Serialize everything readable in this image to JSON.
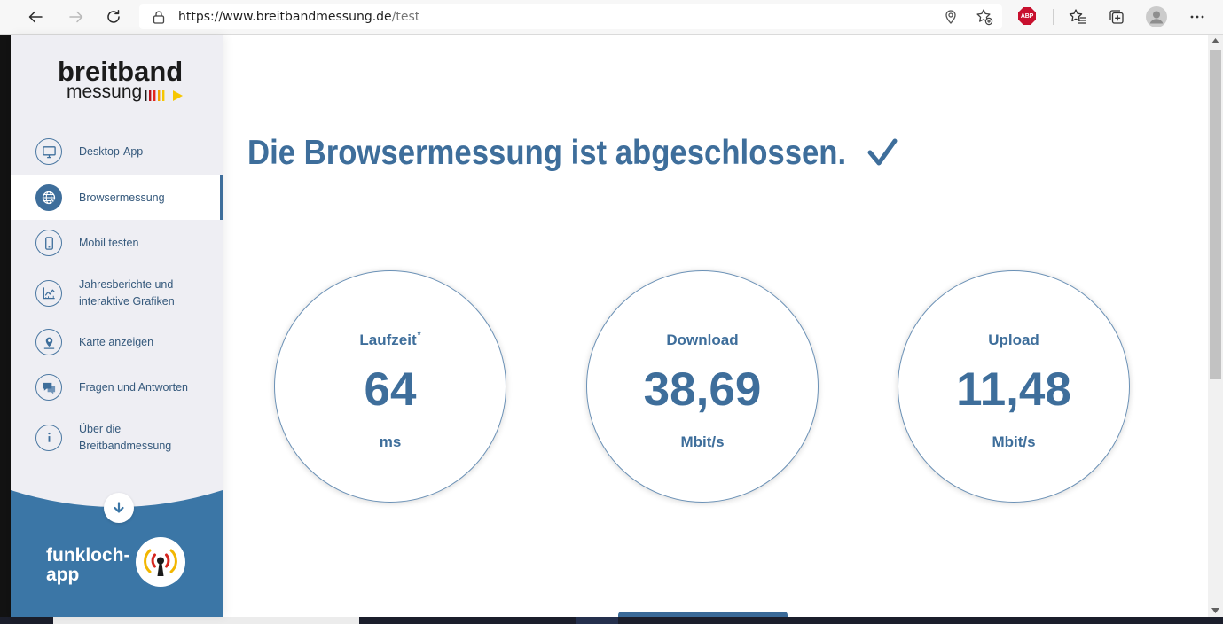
{
  "browser": {
    "url_main": "https://www.breitbandmessung.de",
    "url_path": "/test",
    "extension_badge": "ABP",
    "toolbar_icons": [
      "back-arrow-icon",
      "forward-arrow-icon",
      "refresh-icon",
      "lock-icon",
      "location-icon",
      "add-favorite-icon",
      "adblock-plus-icon",
      "favorites-icon",
      "collections-icon",
      "profile-avatar",
      "more-icon"
    ]
  },
  "sidebar": {
    "logo": {
      "line1": "breitband",
      "line2": "messung"
    },
    "items": [
      {
        "lines": [
          "Desktop-App"
        ],
        "icon": "monitor-icon",
        "active": false
      },
      {
        "lines": [
          "Browsermessung"
        ],
        "icon": "globe-icon",
        "active": true
      },
      {
        "lines": [
          "Mobil testen"
        ],
        "icon": "smartphone-icon",
        "active": false
      },
      {
        "lines": [
          "Jahresberichte und",
          "interaktive Grafiken"
        ],
        "icon": "chart-icon",
        "active": false
      },
      {
        "lines": [
          "Karte anzeigen"
        ],
        "icon": "map-pin-icon",
        "active": false
      },
      {
        "lines": [
          "Fragen und Antworten"
        ],
        "icon": "chat-icon",
        "active": false
      },
      {
        "lines": [
          "Über die",
          "Breitbandmessung"
        ],
        "icon": "info-icon",
        "active": false
      }
    ],
    "promo": {
      "lines": [
        "funkloch-",
        "app"
      ],
      "icon": "funkloch-app-logo",
      "scroll_icon": "arrow-down-icon"
    }
  },
  "main": {
    "heading": "Die Browsermessung ist abgeschlossen.",
    "heading_icon": "checkmark-icon",
    "results": [
      {
        "label": "Laufzeit",
        "footnote_mark": "*",
        "value": "64",
        "unit": "ms"
      },
      {
        "label": "Download",
        "value": "38,69",
        "unit": "Mbit/s"
      },
      {
        "label": "Upload",
        "value": "11,48",
        "unit": "Mbit/s"
      }
    ]
  },
  "colors": {
    "accent": "#3e6e9b",
    "sidebar_bg": "#eeeef3",
    "nav_text": "#35597c",
    "promo_bg": "#3b76a6",
    "abp_red": "#c8102e"
  }
}
